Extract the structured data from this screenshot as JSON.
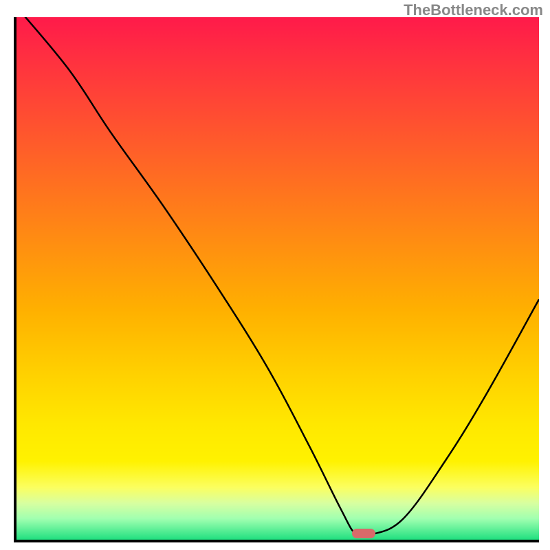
{
  "watermark": "TheBottleneck.com",
  "chart_data": {
    "type": "line",
    "title": "",
    "xlabel": "",
    "ylabel": "",
    "xlim": [
      0,
      100
    ],
    "ylim": [
      0,
      100
    ],
    "series": [
      {
        "name": "curve",
        "x": [
          0,
          10,
          18,
          28,
          38,
          48,
          56,
          62,
          65,
          68,
          74,
          82,
          90,
          100
        ],
        "values": [
          102,
          90,
          78,
          64,
          49,
          33,
          18,
          6,
          1,
          1,
          4,
          15,
          28,
          46
        ]
      }
    ],
    "marker": {
      "x": 66.5,
      "y": 1.2,
      "color": "#d86a6a"
    },
    "gradient_colors_top_to_bottom": [
      "#ff1a4a",
      "#ff7020",
      "#ffd000",
      "#fbff60",
      "#20e080"
    ]
  }
}
